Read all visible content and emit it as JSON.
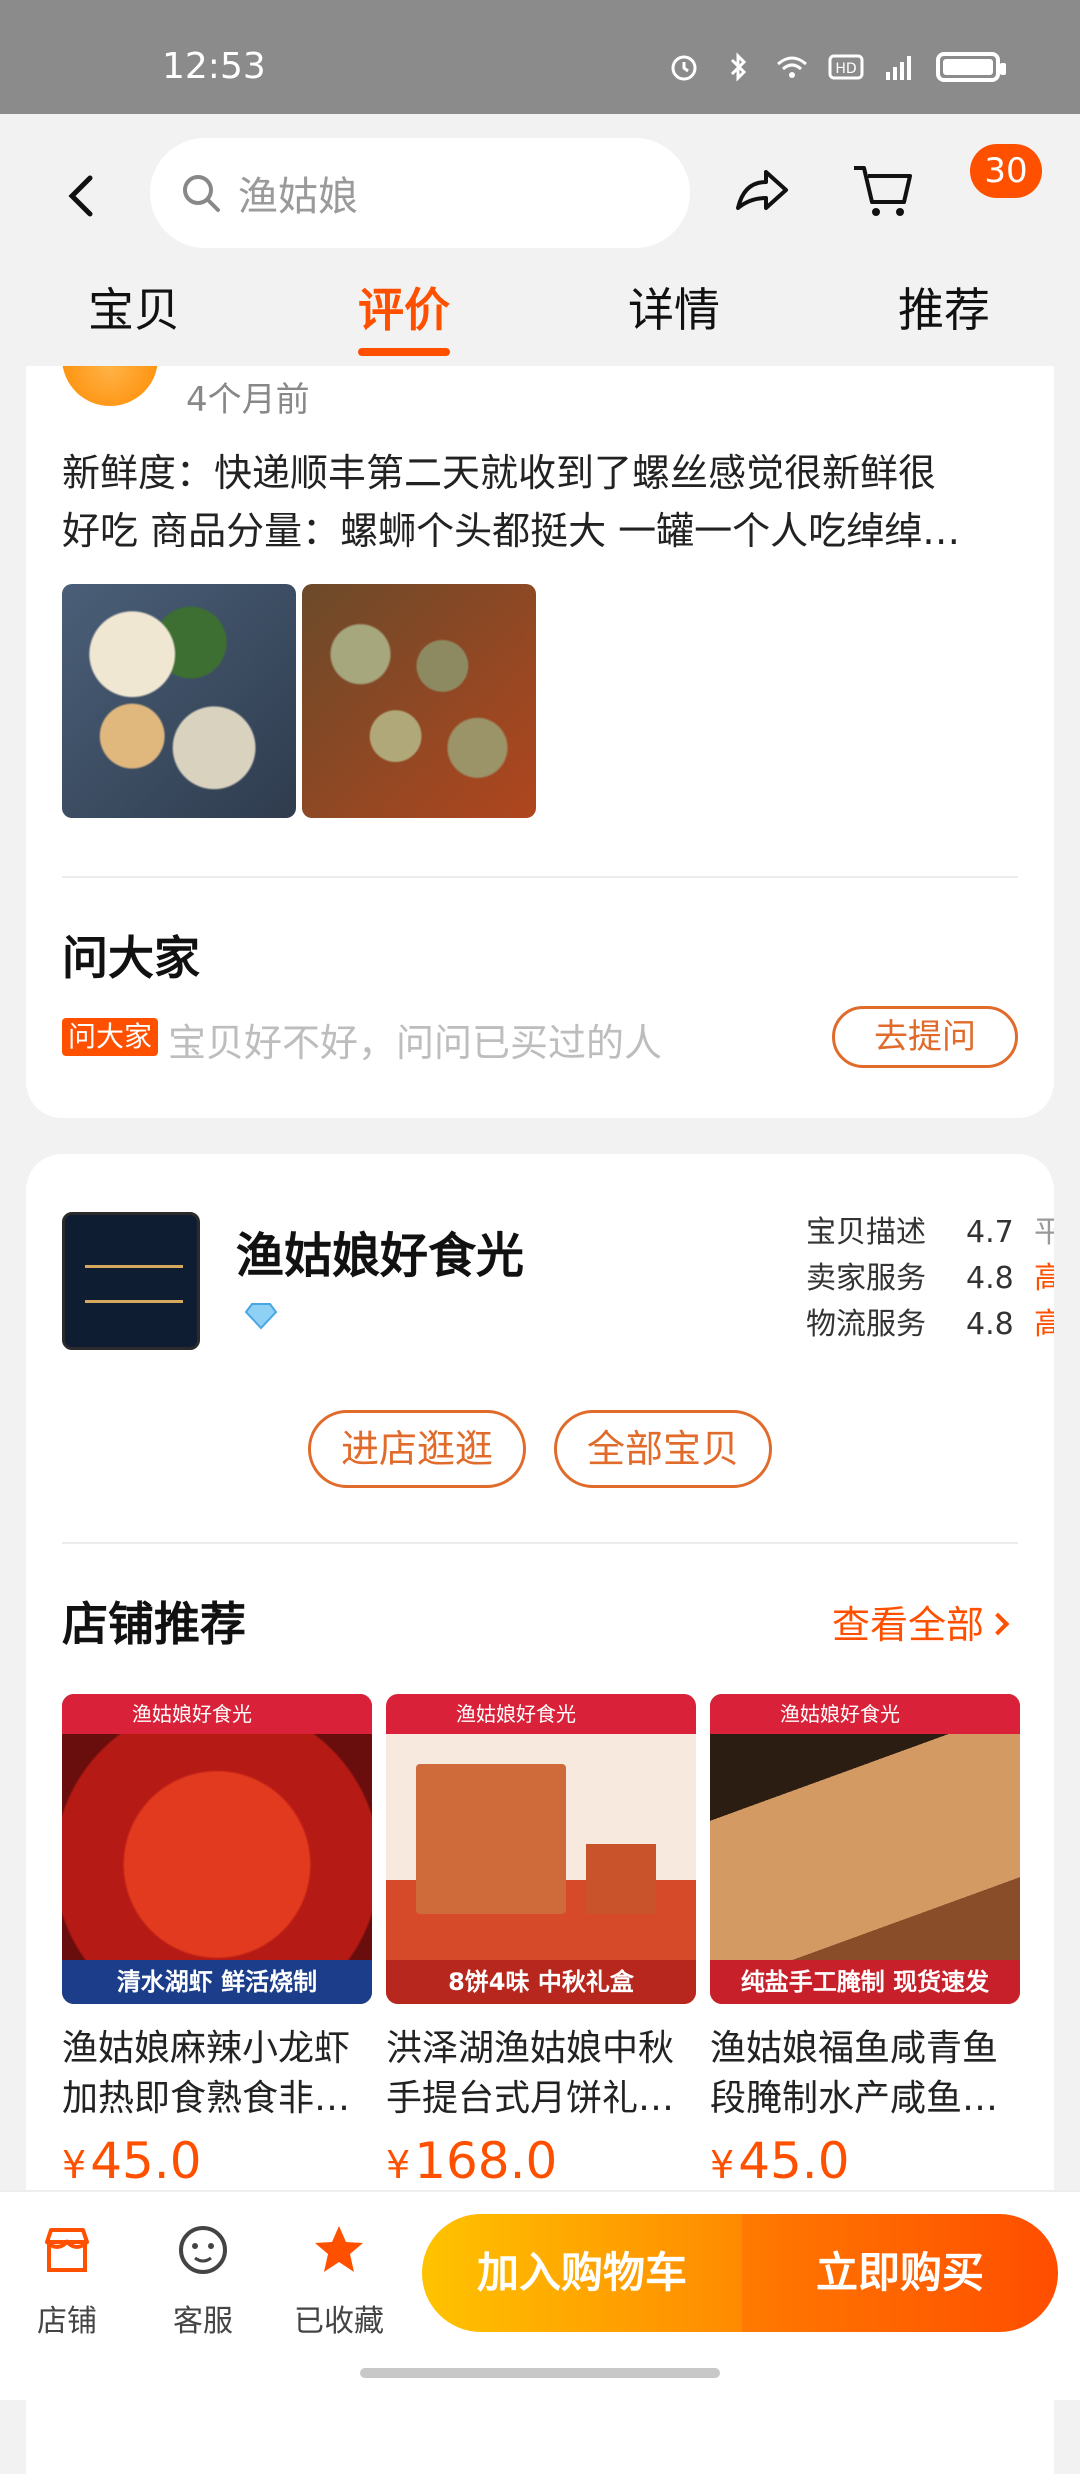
{
  "status_bar": {
    "time": "12:53"
  },
  "header": {
    "search_query": "渔姑娘",
    "cart_badge": "30"
  },
  "tabs": [
    "宝贝",
    "评价",
    "详情",
    "推荐"
  ],
  "review": {
    "date": "4个月前",
    "text_line1": "新鲜度：快递顺丰第二天就收到了螺丝感觉很新鲜很",
    "text_line2": "好吃 商品分量：螺蛳个头都挺大 一罐一个人吃绰绰…"
  },
  "ask": {
    "title": "问大家",
    "tag": "问大家",
    "placeholder": "宝贝好不好，问问已买过的人",
    "button": "去提问"
  },
  "shop": {
    "name": "渔姑娘好食光",
    "ratings": [
      {
        "label": "宝贝描述",
        "value": "4.7",
        "level": "平"
      },
      {
        "label": "卖家服务",
        "value": "4.8",
        "level": "高"
      },
      {
        "label": "物流服务",
        "value": "4.8",
        "level": "高"
      }
    ],
    "enter_button": "进店逛逛",
    "all_button": "全部宝贝"
  },
  "recommend": {
    "title": "店铺推荐",
    "more": "查看全部",
    "products": [
      {
        "name_line1": "渔姑娘麻辣小龙虾",
        "name_line2": "加热即食熟食非…",
        "price": "45.0",
        "strip": "清水湖虾 鲜活烧制",
        "topbar": "渔姑娘好食光"
      },
      {
        "name_line1": "洪泽湖渔姑娘中秋",
        "name_line2": "手提台式月饼礼…",
        "price": "168.0",
        "strip": "8饼4味 中秋礼盒",
        "topbar": "渔姑娘好食光"
      },
      {
        "name_line1": "渔姑娘福鱼咸青鱼",
        "name_line2": "段腌制水产咸鱼…",
        "price": "45.0",
        "strip": "纯盐手工腌制 现货速发",
        "topbar": "渔姑娘好食光"
      }
    ],
    "currency": "¥"
  },
  "bottom_bar": {
    "store": "店铺",
    "service": "客服",
    "favorited": "已收藏",
    "add_to_cart": "加入购物车",
    "buy_now": "立即购买"
  },
  "colors": {
    "accent": "#ff5000",
    "cta_yellow": "#ffc300"
  }
}
